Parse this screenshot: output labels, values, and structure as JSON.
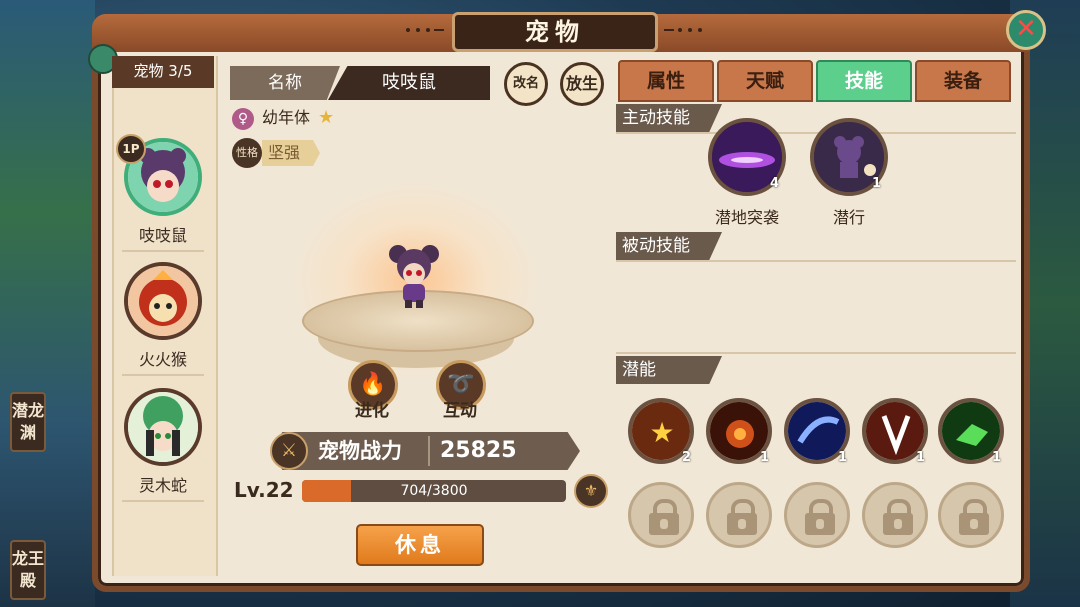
{
  "window": {
    "title": "宠物"
  },
  "side_tabs": {
    "left_1": "潜龙渊",
    "left_2": "龙王殿"
  },
  "pet_list": {
    "count_label": "宠物 3/5",
    "pets": [
      {
        "name": "吱吱鼠",
        "badge": "1P"
      },
      {
        "name": "火火猴"
      },
      {
        "name": "灵木蛇"
      }
    ]
  },
  "pet_detail": {
    "name_label": "名称",
    "name_value": "吱吱鼠",
    "rename_icon": "改名",
    "release_icon": "放生",
    "stage": "幼年体",
    "trait_key": "性格",
    "trait_value": "坚强",
    "evolve_label": "进化",
    "interact_label": "互动",
    "power_label": "宠物战力",
    "power_value": "25825",
    "level": "Lv.22",
    "xp_text": "704/3800",
    "xp_fraction": 0.185,
    "rest_label": "休息"
  },
  "tabs": [
    {
      "label": "属性",
      "active": false
    },
    {
      "label": "天赋",
      "active": false
    },
    {
      "label": "技能",
      "active": true
    },
    {
      "label": "装备",
      "active": false
    }
  ],
  "skills": {
    "active_title": "主动技能",
    "active": [
      {
        "name": "潜地突袭",
        "count": "4"
      },
      {
        "name": "潜行",
        "count": "1"
      }
    ],
    "passive_title": "被动技能",
    "potential_title": "潜能",
    "potential": [
      {
        "count": "2",
        "color": "#f0a030"
      },
      {
        "count": "1",
        "color": "#d0501a"
      },
      {
        "count": "1",
        "color": "#3a5adf"
      },
      {
        "count": "1",
        "color": "#c0401a"
      },
      {
        "count": "1",
        "color": "#3fb84a"
      }
    ]
  }
}
